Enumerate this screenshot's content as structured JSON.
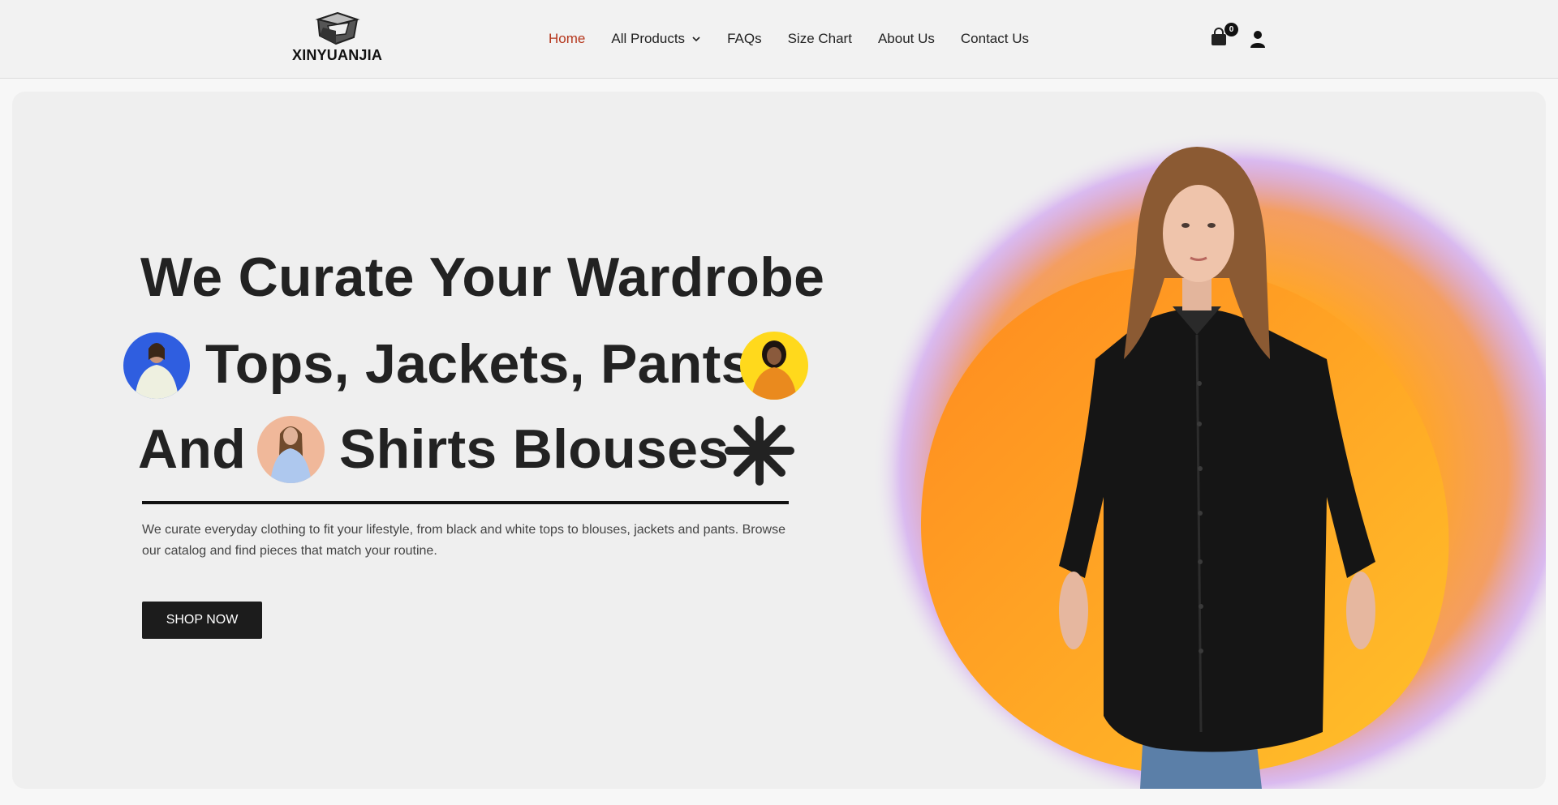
{
  "brand": {
    "name": "XINYUANJIA",
    "logo_icon": "folded-cube-logo"
  },
  "nav": {
    "items": [
      {
        "label": "Home",
        "active": true
      },
      {
        "label": "All Products",
        "has_dropdown": true
      },
      {
        "label": "FAQs"
      },
      {
        "label": "Size Chart"
      },
      {
        "label": "About Us"
      },
      {
        "label": "Contact Us"
      }
    ]
  },
  "header_actions": {
    "cart_icon": "shopping-bag-icon",
    "cart_count": "0",
    "account_icon": "user-icon"
  },
  "hero": {
    "headline_line1": "We Curate Your Wardrobe",
    "headline_line2": "Tops, Jackets, Pants",
    "headline_line3_a": "And",
    "headline_line3_b": "Shirts Blouses",
    "description": "We curate everyday clothing to fit your lifestyle, from black and white tops to blouses, jackets and pants. Browse our catalog and find pieces that match your routine.",
    "cta_label": "SHOP NOW",
    "decor_icon": "asterisk-icon"
  },
  "colors": {
    "accent": "#b5371d",
    "text": "#222222",
    "button_bg": "#1c1c1c",
    "hero_bg": "#efefef",
    "thumb1_bg": "#2f5ee0",
    "thumb2_bg": "#ffd91c",
    "thumb3_bg": "#f0b89a"
  }
}
